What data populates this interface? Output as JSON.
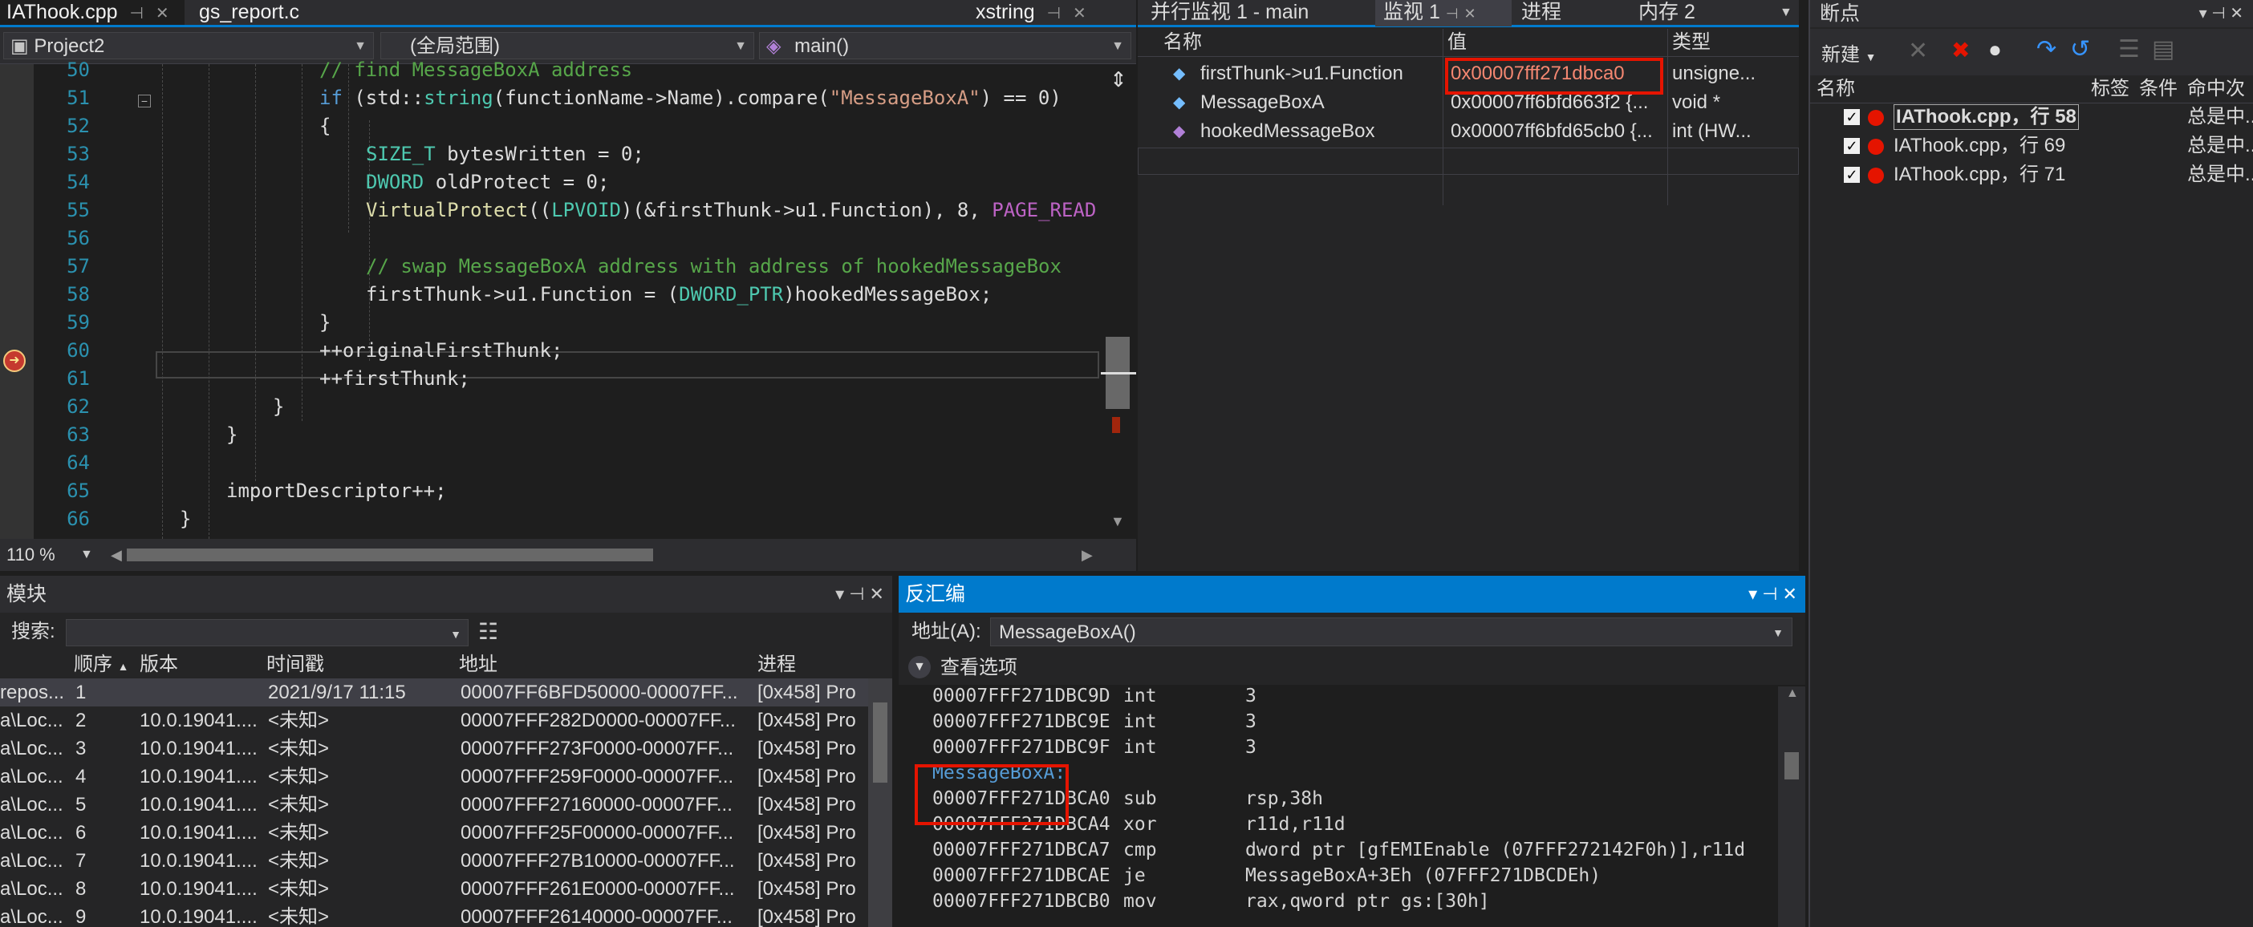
{
  "editor": {
    "tabs": [
      {
        "label": "IAThook.cpp",
        "active": true
      },
      {
        "label": "gs_report.c",
        "active": false
      },
      {
        "label": "xstring",
        "active": false
      }
    ],
    "project_combo": "Project2",
    "scope_combo": "(全局范围)",
    "function_combo": "main()",
    "zoom": "110 %",
    "lines": [
      {
        "num": "50",
        "html": "<span class='c-com'>// find MessageBoxA address</span>",
        "indent": 4
      },
      {
        "num": "51",
        "html": "<span class='c-kw'>if</span> (std::<span class='c-type'>string</span>(functionName-&gt;Name).compare(<span class='c-str'>\"MessageBoxA\"</span>) == 0)",
        "indent": 4
      },
      {
        "num": "52",
        "html": "{",
        "indent": 4
      },
      {
        "num": "53",
        "html": "<span class='c-type'>SIZE_T</span> bytesWritten = 0;",
        "indent": 5
      },
      {
        "num": "54",
        "html": "<span class='c-type'>DWORD</span> oldProtect = 0;",
        "indent": 5
      },
      {
        "num": "55",
        "html": "<span class='c-fn'>VirtualProtect</span>((<span class='c-type'>LPVOID</span>)(&amp;firstThunk-&gt;u1.Function), 8, <span class='c-macro'>PAGE_READ</span>",
        "indent": 5
      },
      {
        "num": "56",
        "html": "",
        "indent": 5
      },
      {
        "num": "57",
        "html": "<span class='c-com'>// swap MessageBoxA address with address of hookedMessageBox</span>",
        "indent": 5
      },
      {
        "num": "58",
        "html": "firstThunk-&gt;u1.Function = (<span class='c-type'>DWORD_PTR</span>)hookedMessageBox;",
        "indent": 5
      },
      {
        "num": "59",
        "html": "}",
        "indent": 4
      },
      {
        "num": "60",
        "html": "++originalFirstThunk;",
        "indent": 4
      },
      {
        "num": "61",
        "html": "++firstThunk;",
        "indent": 4
      },
      {
        "num": "62",
        "html": "}",
        "indent": 3
      },
      {
        "num": "63",
        "html": "}",
        "indent": 2
      },
      {
        "num": "64",
        "html": "",
        "indent": 2
      },
      {
        "num": "65",
        "html": "importDescriptor++;",
        "indent": 2
      },
      {
        "num": "66",
        "html": "}",
        "indent": 1
      }
    ]
  },
  "watch": {
    "tabs": [
      "并行监视 1 - main",
      "监视 1",
      "进程",
      "内存 2"
    ],
    "columns": [
      "名称",
      "值",
      "类型"
    ],
    "rows": [
      {
        "name": "firstThunk->u1.Function",
        "value": "0x00007fff271dbca0",
        "type": "unsigne..."
      },
      {
        "name": "MessageBoxA",
        "value": "0x00007ff6bfd663f2 {...",
        "type": "void *"
      },
      {
        "name": "hookedMessageBox",
        "value": "0x00007ff6bfd65cb0 {...",
        "type": "int (HW..."
      }
    ]
  },
  "breakpoints": {
    "title": "断点",
    "new_label": "新建",
    "columns": [
      "名称",
      "标签",
      "条件",
      "命中次"
    ],
    "rows": [
      {
        "name": "IAThook.cpp，行 58",
        "hit": "总是中..."
      },
      {
        "name": "IAThook.cpp，行 69",
        "hit": "总是中..."
      },
      {
        "name": "IAThook.cpp，行 71",
        "hit": "总是中..."
      }
    ]
  },
  "modules": {
    "title": "模块",
    "search_label": "搜索:",
    "columns": [
      "顺序",
      "版本",
      "时间戳",
      "地址",
      "进程"
    ],
    "rows": [
      {
        "path": "repos...",
        "order": "1",
        "version": "",
        "time": "2021/9/17 11:15",
        "addr": "00007FF6BFD50000-00007FF...",
        "proc": "[0x458] Pro"
      },
      {
        "path": "a\\Loc...",
        "order": "2",
        "version": "10.0.19041....",
        "time": "<未知>",
        "addr": "00007FFF282D0000-00007FF...",
        "proc": "[0x458] Pro"
      },
      {
        "path": "a\\Loc...",
        "order": "3",
        "version": "10.0.19041....",
        "time": "<未知>",
        "addr": "00007FFF273F0000-00007FF...",
        "proc": "[0x458] Pro"
      },
      {
        "path": "a\\Loc...",
        "order": "4",
        "version": "10.0.19041....",
        "time": "<未知>",
        "addr": "00007FFF259F0000-00007FF...",
        "proc": "[0x458] Pro"
      },
      {
        "path": "a\\Loc...",
        "order": "5",
        "version": "10.0.19041....",
        "time": "<未知>",
        "addr": "00007FFF27160000-00007FF...",
        "proc": "[0x458] Pro"
      },
      {
        "path": "a\\Loc...",
        "order": "6",
        "version": "10.0.19041....",
        "time": "<未知>",
        "addr": "00007FFF25F00000-00007FF...",
        "proc": "[0x458] Pro"
      },
      {
        "path": "a\\Loc...",
        "order": "7",
        "version": "10.0.19041....",
        "time": "<未知>",
        "addr": "00007FFF27B10000-00007FF...",
        "proc": "[0x458] Pro"
      },
      {
        "path": "a\\Loc...",
        "order": "8",
        "version": "10.0.19041....",
        "time": "<未知>",
        "addr": "00007FFF261E0000-00007FF...",
        "proc": "[0x458] Pro"
      },
      {
        "path": "a\\Loc...",
        "order": "9",
        "version": "10.0.19041....",
        "time": "<未知>",
        "addr": "00007FFF26140000-00007FF...",
        "proc": "[0x458] Pro"
      }
    ]
  },
  "disasm": {
    "title": "反汇编",
    "address_label": "地址(A):",
    "address_value": "MessageBoxA()",
    "options_label": "查看选项",
    "lines": [
      {
        "addr": "00007FFF271DBC9D",
        "op": "int",
        "args": "3"
      },
      {
        "addr": "00007FFF271DBC9E",
        "op": "int",
        "args": "3"
      },
      {
        "addr": "00007FFF271DBC9F",
        "op": "int",
        "args": "3"
      },
      {
        "label": "MessageBoxA:"
      },
      {
        "addr": "00007FFF271DBCA0",
        "op": "sub",
        "args": "rsp,38h"
      },
      {
        "addr": "00007FFF271DBCA4",
        "op": "xor",
        "args": "r11d,r11d"
      },
      {
        "addr": "00007FFF271DBCA7",
        "op": "cmp",
        "args": "dword ptr [gfEMIEnable (07FFF272142F0h)],r11d"
      },
      {
        "addr": "00007FFF271DBCAE",
        "op": "je",
        "args": "MessageBoxA+3Eh (07FFF271DBCDEh)"
      },
      {
        "addr": "00007FFF271DBCB0",
        "op": "mov",
        "args": "rax,qword ptr gs:[30h]"
      }
    ]
  }
}
